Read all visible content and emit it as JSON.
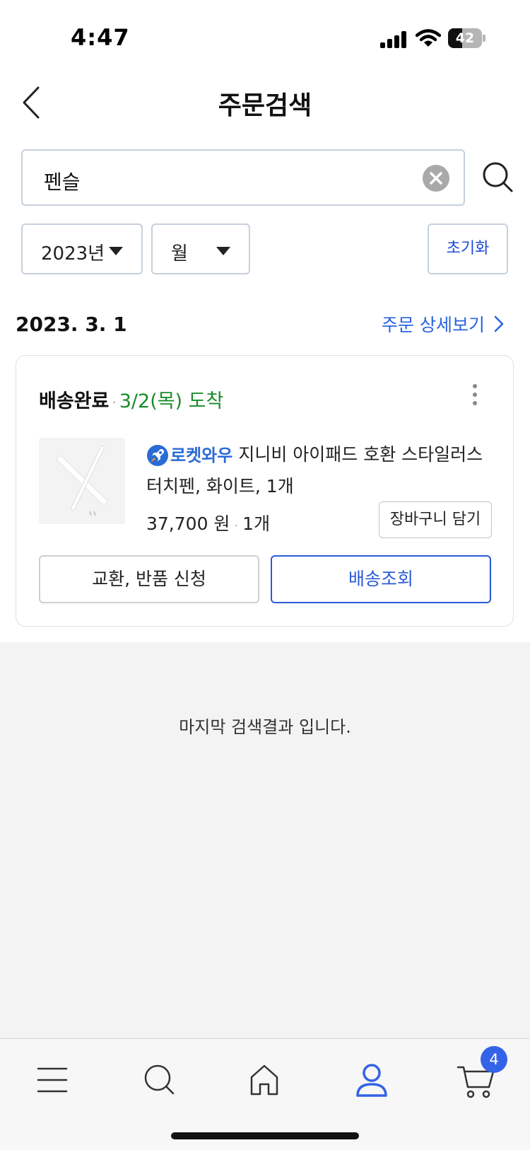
{
  "status_bar": {
    "time": "4:47",
    "battery_percent": "42",
    "battery_level": 0.42
  },
  "header": {
    "title": "주문검색",
    "back_icon": "chevron-left-icon"
  },
  "search": {
    "query": "펜슬",
    "clear_icon": "clear-icon",
    "search_icon": "search-icon"
  },
  "filters": {
    "year": "2023년",
    "month": "월",
    "reset_label": "초기화"
  },
  "order": {
    "date": "2023. 3. 1",
    "detail_label": "주문 상세보기",
    "status": "배송완료",
    "arrival": "3/2(목) 도착",
    "product": {
      "badge": "로켓와우",
      "title": "지니비 아이패드 호환 스타일러스 터치펜, 화이트, 1개",
      "price": "37,700 원",
      "quantity": "1개"
    },
    "cart_add_label": "장바구니 담기",
    "return_label": "교환, 반품 신청",
    "tracking_label": "배송조회"
  },
  "end_message": "마지막 검색결과 입니다.",
  "tab_bar": {
    "items": [
      {
        "icon": "menu-icon"
      },
      {
        "icon": "search-icon"
      },
      {
        "icon": "home-icon"
      },
      {
        "icon": "user-icon",
        "active": true
      },
      {
        "icon": "cart-icon"
      }
    ],
    "cart_count": "4"
  },
  "colors": {
    "accent": "#2a5bd7",
    "link": "#2a63e0",
    "arrival": "#1a8c2b",
    "active_tab": "#3463e8"
  }
}
